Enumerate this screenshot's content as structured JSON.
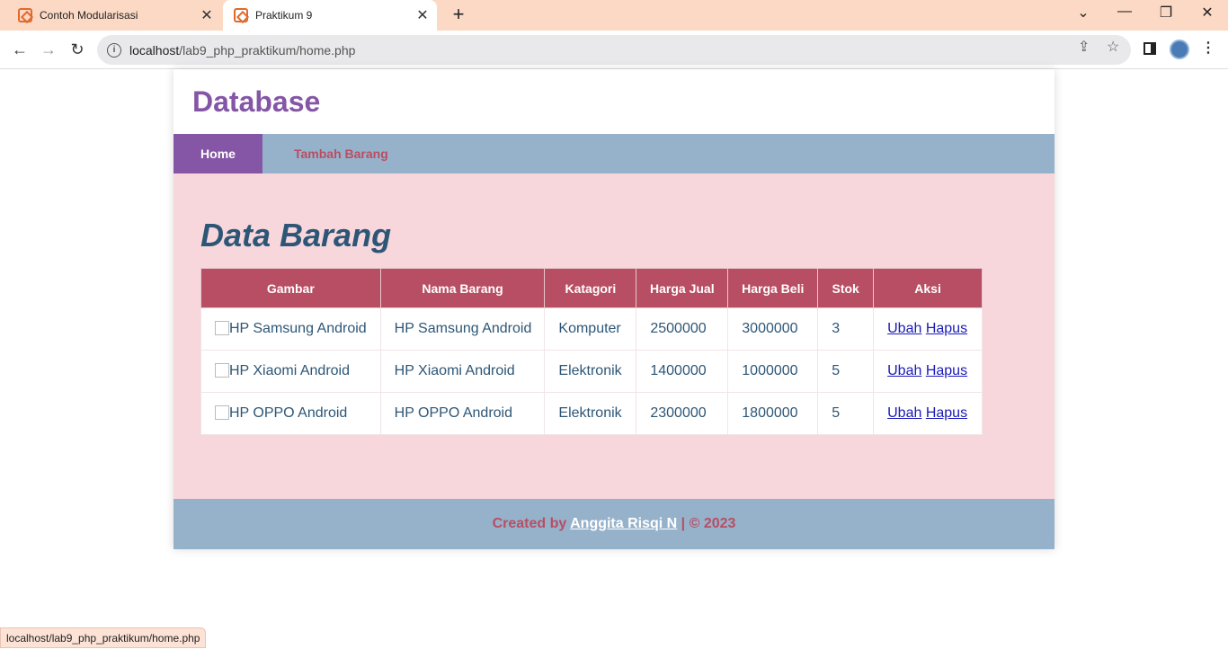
{
  "browser": {
    "tabs": [
      {
        "title": "Contoh Modularisasi",
        "active": false
      },
      {
        "title": "Praktikum 9",
        "active": true
      }
    ],
    "url": {
      "host": "localhost",
      "path": "/lab9_php_praktikum/home.php"
    },
    "status_url": "localhost/lab9_php_praktikum/home.php"
  },
  "header": {
    "title": "Database"
  },
  "nav": {
    "home": "Home",
    "tambah": "Tambah Barang"
  },
  "content": {
    "heading": "Data Barang",
    "columns": [
      "Gambar",
      "Nama Barang",
      "Katagori",
      "Harga Jual",
      "Harga Beli",
      "Stok",
      "Aksi"
    ],
    "rows": [
      {
        "gambar": "HP Samsung Android",
        "nama": "HP Samsung Android",
        "kategori": "Komputer",
        "harga_jual": "2500000",
        "harga_beli": "3000000",
        "stok": "3",
        "ubah": "Ubah",
        "hapus": "Hapus"
      },
      {
        "gambar": "HP Xiaomi Android",
        "nama": "HP Xiaomi Android",
        "kategori": "Elektronik",
        "harga_jual": "1400000",
        "harga_beli": "1000000",
        "stok": "5",
        "ubah": "Ubah",
        "hapus": "Hapus"
      },
      {
        "gambar": "HP OPPO Android",
        "nama": "HP OPPO Android",
        "kategori": "Elektronik",
        "harga_jual": "2300000",
        "harga_beli": "1800000",
        "stok": "5",
        "ubah": "Ubah",
        "hapus": "Hapus"
      }
    ]
  },
  "footer": {
    "prefix": "Created by ",
    "author": "Anggita Risqi N",
    "suffix": " | © 2023"
  },
  "colors": {
    "purple": "#8556a6",
    "blue_bar": "#96b2cb",
    "pink_bg": "#f8d7dc",
    "red": "#b84e63",
    "heading": "#2d5676"
  }
}
